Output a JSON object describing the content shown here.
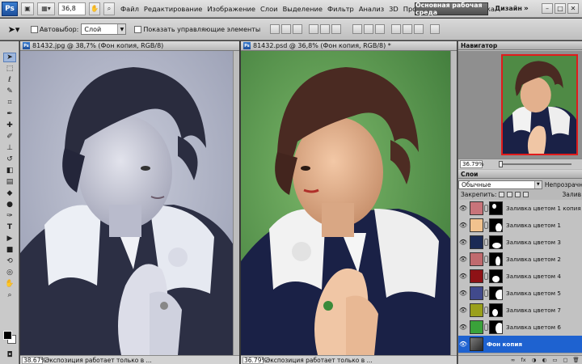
{
  "menubar": {
    "logo": "Ps",
    "zoom": "36,8",
    "items": [
      "Файл",
      "Редактирование",
      "Изображение",
      "Слои",
      "Выделение",
      "Фильтр",
      "Анализ",
      "3D",
      "Просмотр",
      "Окно",
      "Справка"
    ],
    "workspace_active": "Основная рабочая среда",
    "workspace_design": "Дизайн",
    "more": "»"
  },
  "options": {
    "autoselect_label": "Автовыбор:",
    "autoselect_value": "Слой",
    "show_controls_label": "Показать управляющие элементы"
  },
  "docs": [
    {
      "title": "81432.jpg @ 38,7% (Фон копия, RGB/8)",
      "status_zoom": "38.67%",
      "status_text": "Экспозиция работает только в ..."
    },
    {
      "title": "81432.psd @ 36,8% (Фон копия, RGB/8) *",
      "status_zoom": "36.79%",
      "status_text": "Экспозиция работает только в ..."
    }
  ],
  "navigator": {
    "title": "Навигатор",
    "zoom": "36.79%"
  },
  "layers": {
    "title": "Слои",
    "blend_mode": "Обычные",
    "opacity_label": "Непрозрачн",
    "lock_label": "Закрепить:",
    "fill_label": "Залив",
    "items": [
      {
        "name": "Заливка цветом 1 копия",
        "color": "#c8747a"
      },
      {
        "name": "Заливка цветом 1",
        "color": "#f1c28e"
      },
      {
        "name": "Заливка цветом 3",
        "color": "#1b2a55"
      },
      {
        "name": "Заливка цветом 2",
        "color": "#c06a6e"
      },
      {
        "name": "Заливка цветом 4",
        "color": "#8e1216"
      },
      {
        "name": "Заливка цветом 5",
        "color": "#414a8c"
      },
      {
        "name": "Заливка цветом 7",
        "color": "#9aa01b"
      },
      {
        "name": "Заливка цветом 6",
        "color": "#3aa23a"
      },
      {
        "name": "Фон копия",
        "color": "#2f2f2f",
        "active": true
      }
    ]
  }
}
